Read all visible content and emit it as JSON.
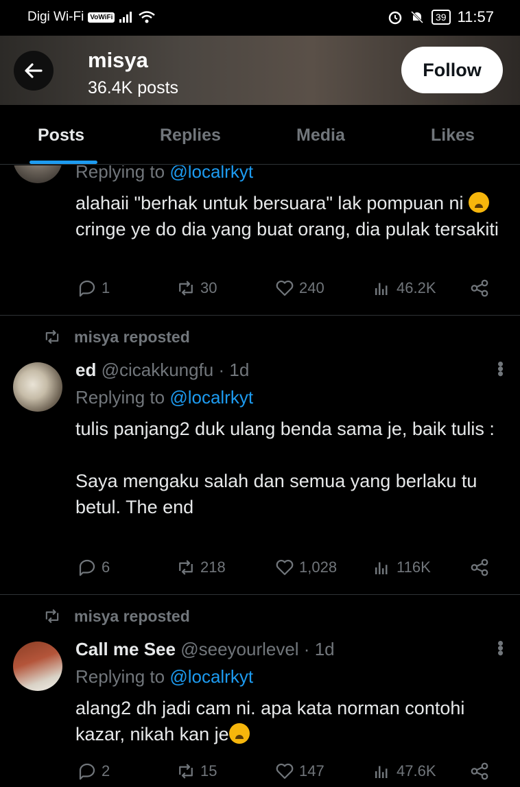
{
  "status_bar": {
    "carrier": "Digi Wi-Fi",
    "vowifi": "VoWiFi",
    "battery": "39",
    "time": "11:57"
  },
  "header": {
    "name": "misya",
    "post_count": "36.4K posts",
    "follow_label": "Follow"
  },
  "tabs": [
    "Posts",
    "Replies",
    "Media",
    "Likes"
  ],
  "tweets": [
    {
      "replying_prefix": "Replying to ",
      "replying_to": "@localrkyt",
      "text_a": "alahaii \"berhak untuk bersuara\" lak pompuan ni ",
      "text_b": " cringe ye do dia yang buat orang, dia pulak tersakiti",
      "replies": "1",
      "reposts": "30",
      "likes": "240",
      "views": "46.2K"
    },
    {
      "repost_label": "misya reposted",
      "name": "ed",
      "handle_time": "@cicakkungfu · 1d",
      "replying_prefix": "Replying to ",
      "replying_to": "@localrkyt",
      "text": "tulis panjang2 duk ulang benda sama je, baik tulis :\n\nSaya mengaku salah dan semua yang berlaku tu betul. The end",
      "replies": "6",
      "reposts": "218",
      "likes": "1,028",
      "views": "116K"
    },
    {
      "repost_label": "misya reposted",
      "name": "Call me See",
      "handle_time": "@seeyourlevel · 1d",
      "replying_prefix": "Replying to ",
      "replying_to": "@localrkyt",
      "text": "alang2 dh jadi cam ni. apa kata norman contohi kazar, nikah kan je",
      "replies": "2",
      "reposts": "15",
      "likes": "147",
      "views": "47.6K"
    }
  ],
  "colors": {
    "background": "#000000",
    "text": "#e7e9ea",
    "muted": "#71767b",
    "accent": "#1d9bf0",
    "divider": "#2f3336"
  }
}
